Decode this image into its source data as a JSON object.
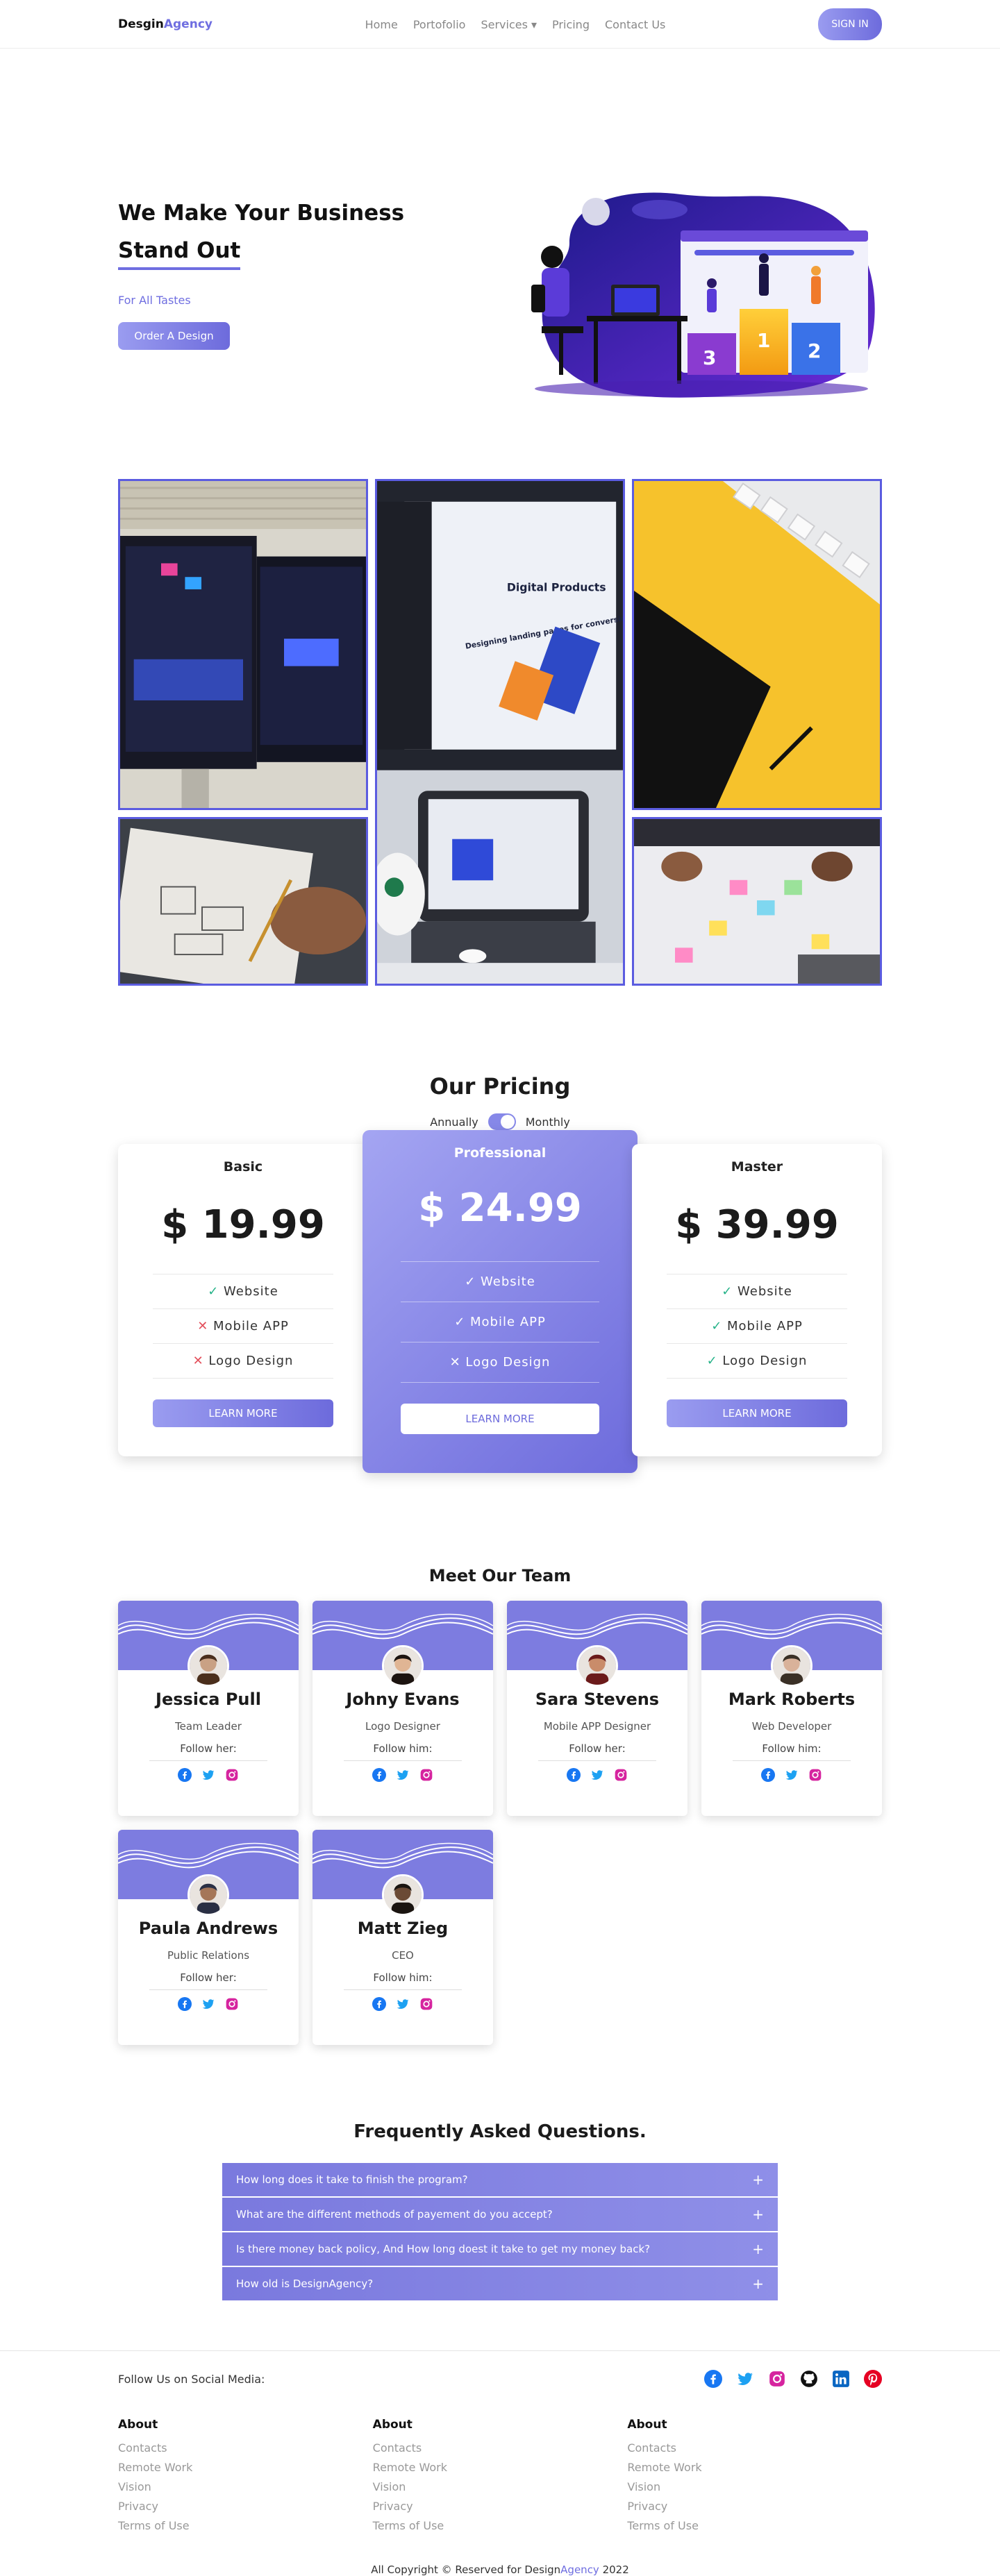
{
  "nav": {
    "logo_part1": "Desgin",
    "logo_part2": "Agency",
    "items": [
      "Home",
      "Portofolio",
      "Services ▾",
      "Pricing",
      "Contact Us"
    ],
    "signin": "SIGN IN"
  },
  "hero": {
    "line1": "We Make Your Business",
    "line2": "Stand Out",
    "subtitle": "For All Tastes",
    "cta": "Order A Design",
    "podium": [
      "3",
      "1",
      "2"
    ]
  },
  "gallery": {
    "screen_headline": "Digital Products",
    "screen_subline": "Designing landing pages for conversion"
  },
  "pricing": {
    "title": "Our Pricing",
    "toggle_left": "Annually",
    "toggle_right": "Monthly",
    "plans": [
      {
        "name": "Basic",
        "price": "$ 19.99",
        "features": [
          {
            "mark": "✓",
            "text": "Website"
          },
          {
            "mark": "✕",
            "text": "Mobile APP"
          },
          {
            "mark": "✕",
            "text": "Logo Design"
          }
        ],
        "button": "LEARN MORE"
      },
      {
        "name": "Professional",
        "price": "$ 24.99",
        "features": [
          {
            "mark": "✓",
            "text": "Website"
          },
          {
            "mark": "✓",
            "text": "Mobile APP"
          },
          {
            "mark": "✕",
            "text": "Logo Design"
          }
        ],
        "button": "LEARN MORE"
      },
      {
        "name": "Master",
        "price": "$ 39.99",
        "features": [
          {
            "mark": "✓",
            "text": "Website"
          },
          {
            "mark": "✓",
            "text": "Mobile APP"
          },
          {
            "mark": "✓",
            "text": "Logo Design"
          }
        ],
        "button": "LEARN MORE"
      }
    ]
  },
  "team": {
    "title": "Meet Our Team",
    "members": [
      {
        "name": "Jessica Pull",
        "role": "Team Leader",
        "follow": "Follow her:"
      },
      {
        "name": "Johny Evans",
        "role": "Logo Designer",
        "follow": "Follow him:"
      },
      {
        "name": "Sara Stevens",
        "role": "Mobile APP Designer",
        "follow": "Follow her:"
      },
      {
        "name": "Mark Roberts",
        "role": "Web Developer",
        "follow": "Follow him:"
      },
      {
        "name": "Paula Andrews",
        "role": "Public Relations",
        "follow": "Follow her:"
      },
      {
        "name": "Matt Zieg",
        "role": "CEO",
        "follow": "Follow him:"
      }
    ]
  },
  "faq": {
    "title": "Frequently Asked Questions.",
    "items": [
      "How long does it take to finish the program?",
      "What are the different methods of payement do you accept?",
      "Is there money back policy, And How long doest it take to get my money back?",
      "How old is DesignAgency?"
    ],
    "toggle_symbol": "+"
  },
  "footer": {
    "follow_label": "Follow Us on Social Media:",
    "columns": [
      {
        "title": "About",
        "links": [
          "Contacts",
          "Remote Work",
          "Vision",
          "Privacy",
          "Terms of Use"
        ]
      },
      {
        "title": "About",
        "links": [
          "Contacts",
          "Remote Work",
          "Vision",
          "Privacy",
          "Terms of Use"
        ]
      },
      {
        "title": "About",
        "links": [
          "Contacts",
          "Remote Work",
          "Vision",
          "Privacy",
          "Terms of Use"
        ]
      }
    ],
    "copyright_pre": "All Copyright © Reserved for Design",
    "copyright_accent": "Agency",
    "copyright_post": " 2022"
  },
  "colors": {
    "accent": "#6f6ee0",
    "gradient_start": "#9a9cf0",
    "gradient_end": "#6d6bdc",
    "ok": "#26b389",
    "no": "#e34f5b"
  },
  "icons": [
    "facebook-icon",
    "twitter-icon",
    "instagram-icon",
    "github-icon",
    "linkedin-icon",
    "pinterest-icon"
  ]
}
